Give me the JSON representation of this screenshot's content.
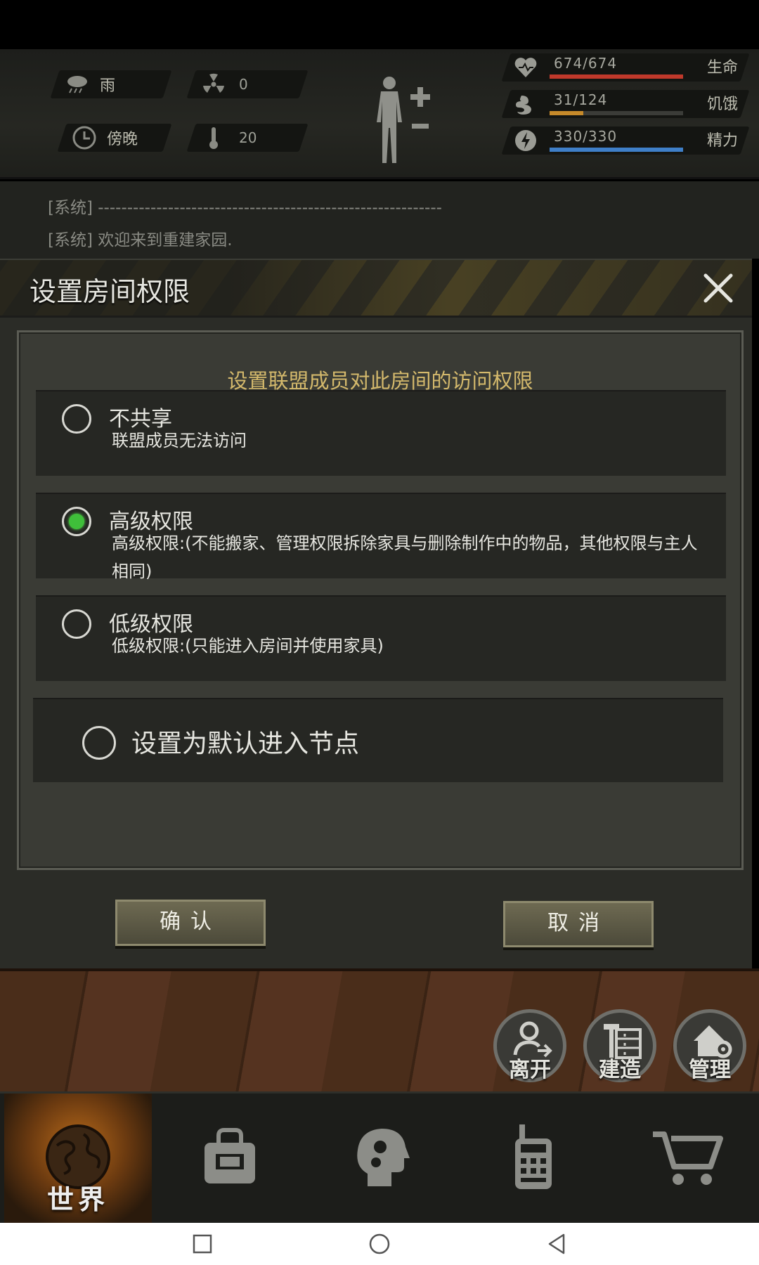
{
  "hud": {
    "weather": {
      "icon": "rain-cloud-icon",
      "text": "雨"
    },
    "radiation": {
      "icon": "radiation-icon",
      "value": "0"
    },
    "time": {
      "icon": "clock-icon",
      "text": "傍晚"
    },
    "temperature": {
      "icon": "thermometer-icon",
      "value": "20"
    },
    "stats": [
      {
        "icon": "heart-icon",
        "value": "674/674",
        "label": "生命",
        "fill": 1.0,
        "color": "#c0392b"
      },
      {
        "icon": "stomach-icon",
        "value": "31/124",
        "label": "饥饿",
        "fill": 0.25,
        "color": "#c68a2a"
      },
      {
        "icon": "energy-icon",
        "value": "330/330",
        "label": "精力",
        "fill": 1.0,
        "color": "#3f7fc8"
      }
    ]
  },
  "chat": {
    "lines": [
      "[系统] -----------------------------------------------------------",
      "[系统] 欢迎来到重建家园."
    ]
  },
  "modal": {
    "title": "设置房间权限",
    "caption": "设置联盟成员对此房间的访问权限",
    "options": [
      {
        "title": "不共享",
        "desc": "联盟成员无法访问",
        "checked": false
      },
      {
        "title": "高级权限",
        "desc": "高级权限:(不能搬家、管理权限拆除家具与删除制作中的物品，其他权限与主人相同)",
        "checked": true
      },
      {
        "title": "低级权限",
        "desc": "低级权限:(只能进入房间并使用家具)",
        "checked": false
      }
    ],
    "default_node": {
      "label": "设置为默认进入节点",
      "checked": false
    },
    "confirm_label": "确认",
    "cancel_label": "取消"
  },
  "room_actions": [
    {
      "icon": "leave-icon",
      "label": "离开"
    },
    {
      "icon": "build-icon",
      "label": "建造"
    },
    {
      "icon": "manage-icon",
      "label": "管理"
    }
  ],
  "bottom_nav": {
    "world_label": "世界",
    "tabs": [
      "world-globe-icon",
      "backpack-icon",
      "brain-gear-icon",
      "radio-icon",
      "cart-icon"
    ]
  },
  "colors": {
    "accent_gold": "#d4b96c",
    "radio_green": "#3fbf3a"
  }
}
